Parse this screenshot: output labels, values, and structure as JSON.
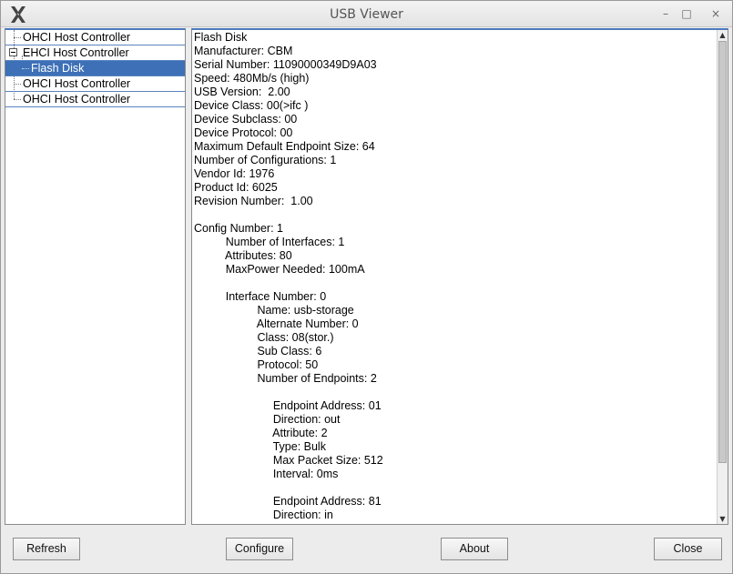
{
  "window": {
    "title": "USB Viewer"
  },
  "titlebar": {
    "minimize": "–",
    "maximize": "□",
    "close": "×"
  },
  "tree": {
    "items": [
      {
        "label": "OHCI Host Controller"
      },
      {
        "label": "EHCI Host Controller"
      },
      {
        "label": "Flash Disk",
        "selected": true
      },
      {
        "label": "OHCI Host Controller"
      },
      {
        "label": "OHCI Host Controller"
      }
    ]
  },
  "details": {
    "lines": [
      "Flash Disk",
      "Manufacturer: CBM",
      "Serial Number: 11090000349D9A03",
      "Speed: 480Mb/s (high)",
      "USB Version:  2.00",
      "Device Class: 00(>ifc )",
      "Device Subclass: 00",
      "Device Protocol: 00",
      "Maximum Default Endpoint Size: 64",
      "Number of Configurations: 1",
      "Vendor Id: 1976",
      "Product Id: 6025",
      "Revision Number:  1.00",
      "",
      "Config Number: 1",
      "          Number of Interfaces: 1",
      "          Attributes: 80",
      "          MaxPower Needed: 100mA",
      "",
      "          Interface Number: 0",
      "                    Name: usb-storage",
      "                    Alternate Number: 0",
      "                    Class: 08(stor.)",
      "                    Sub Class: 6",
      "                    Protocol: 50",
      "                    Number of Endpoints: 2",
      "",
      "                         Endpoint Address: 01",
      "                         Direction: out",
      "                         Attribute: 2",
      "                         Type: Bulk",
      "                         Max Packet Size: 512",
      "                         Interval: 0ms",
      "",
      "                         Endpoint Address: 81",
      "                         Direction: in"
    ]
  },
  "buttons": {
    "refresh": "Refresh",
    "configure": "Configure",
    "about": "About",
    "close": "Close"
  }
}
